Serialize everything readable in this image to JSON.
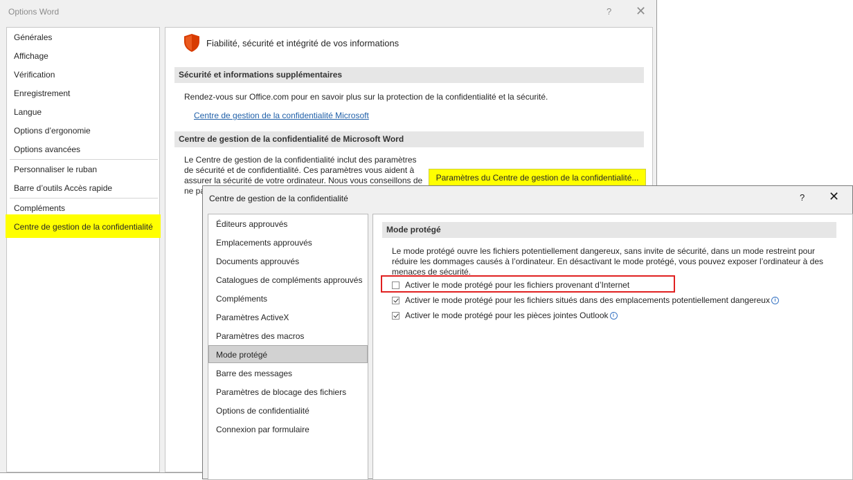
{
  "options_window": {
    "title": "Options Word",
    "help": "?",
    "close": "✕",
    "nav": [
      "Générales",
      "Affichage",
      "Vérification",
      "Enregistrement",
      "Langue",
      "Options d’ergonomie",
      "Options avancées",
      "Personnaliser le ruban",
      "Barre d’outils Accès rapide",
      "Compléments",
      "Centre de gestion de la confidentialité"
    ],
    "selected_nav": "Centre de gestion de la confidentialité",
    "main": {
      "title": "Fiabilité, sécurité et intégrité de vos informations",
      "section1_heading": "Sécurité et informations supplémentaires",
      "section1_text": "Rendez-vous sur Office.com pour en savoir plus sur la protection de la confidentialité et la sécurité.",
      "section1_link": "Centre de gestion de la confidentialité Microsoft",
      "section2_heading": "Centre de gestion de la confidentialité de Microsoft Word",
      "section2_text": "Le Centre de gestion de la confidentialité inclut des paramètres de sécurité et de confidentialité. Ces paramètres vous aident à assurer la sécurité de votre ordinateur. Nous vous conseillons de ne pa",
      "settings_button": "Paramètres du Centre de gestion de la confidentialité..."
    }
  },
  "trust_center": {
    "title": "Centre de gestion de la confidentialité",
    "help": "?",
    "close": "✕",
    "nav": [
      "Éditeurs approuvés",
      "Emplacements approuvés",
      "Documents approuvés",
      "Catalogues de compléments approuvés",
      "Compléments",
      "Paramètres ActiveX",
      "Paramètres des macros",
      "Mode protégé",
      "Barre des messages",
      "Paramètres de blocage des fichiers",
      "Options de confidentialité",
      "Connexion par formulaire"
    ],
    "selected_nav": "Mode protégé",
    "section_heading": "Mode protégé",
    "description": "Le mode protégé ouvre les fichiers potentiellement dangereux, sans invite de sécurité, dans un mode restreint pour réduire les dommages causés à l’ordinateur. En désactivant le mode protégé, vous pouvez exposer l’ordinateur à des menaces de sécurité.",
    "options": [
      {
        "label": "Activer le mode protégé pour les fichiers provenant d’Internet",
        "checked": false,
        "info": false
      },
      {
        "label": "Activer le mode protégé pour les fichiers situés dans des emplacements potentiellement dangereux",
        "checked": true,
        "info": true
      },
      {
        "label": "Activer le mode protégé pour les pièces jointes Outlook",
        "checked": true,
        "info": true
      }
    ]
  },
  "colors": {
    "highlight": "#ffff00",
    "annotation_box": "#e02020",
    "link": "#1f5fa8",
    "shield": "#d83b01"
  }
}
